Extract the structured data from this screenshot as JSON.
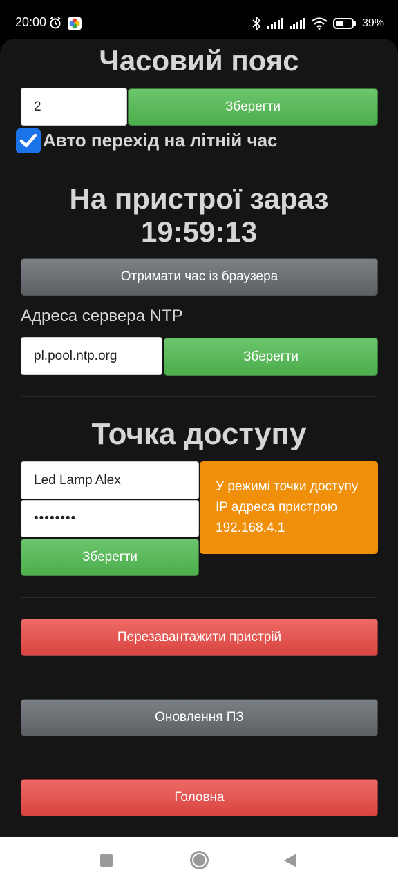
{
  "status_bar": {
    "time": "20:00",
    "battery_percent": "39%",
    "icons": [
      "alarm-icon",
      "app-notification-icon",
      "bluetooth-icon",
      "signal-icon",
      "signal-icon",
      "wifi-icon",
      "battery-icon"
    ]
  },
  "timezone": {
    "title": "Часовий пояс",
    "value": "2",
    "save_label": "Зберегти",
    "dst_checkbox_checked": true,
    "dst_label": "Авто перехід на літній час"
  },
  "device_time": {
    "title": "На пристрої зараз",
    "time": "19:59:13",
    "browser_time_button": "Отримати час із браузера"
  },
  "ntp": {
    "label": "Адреса сервера NTP",
    "value": "pl.pool.ntp.org",
    "save_label": "Зберегти"
  },
  "access_point": {
    "title": "Точка доступу",
    "ssid": "Led Lamp Alex",
    "password": "••••••••",
    "save_label": "Зберегти",
    "info_text": "У режимі точки доступу IP адреса пристрою 192.168.4.1"
  },
  "actions": {
    "restart_label": "Перезавантажити пристрій",
    "update_label": "Оновлення ПЗ",
    "home_label": "Головна"
  },
  "colors": {
    "green": "#5cb85c",
    "gray": "#6c7075",
    "red": "#e5534e",
    "orange": "#f0900a",
    "checkbox": "#1a73e8"
  }
}
